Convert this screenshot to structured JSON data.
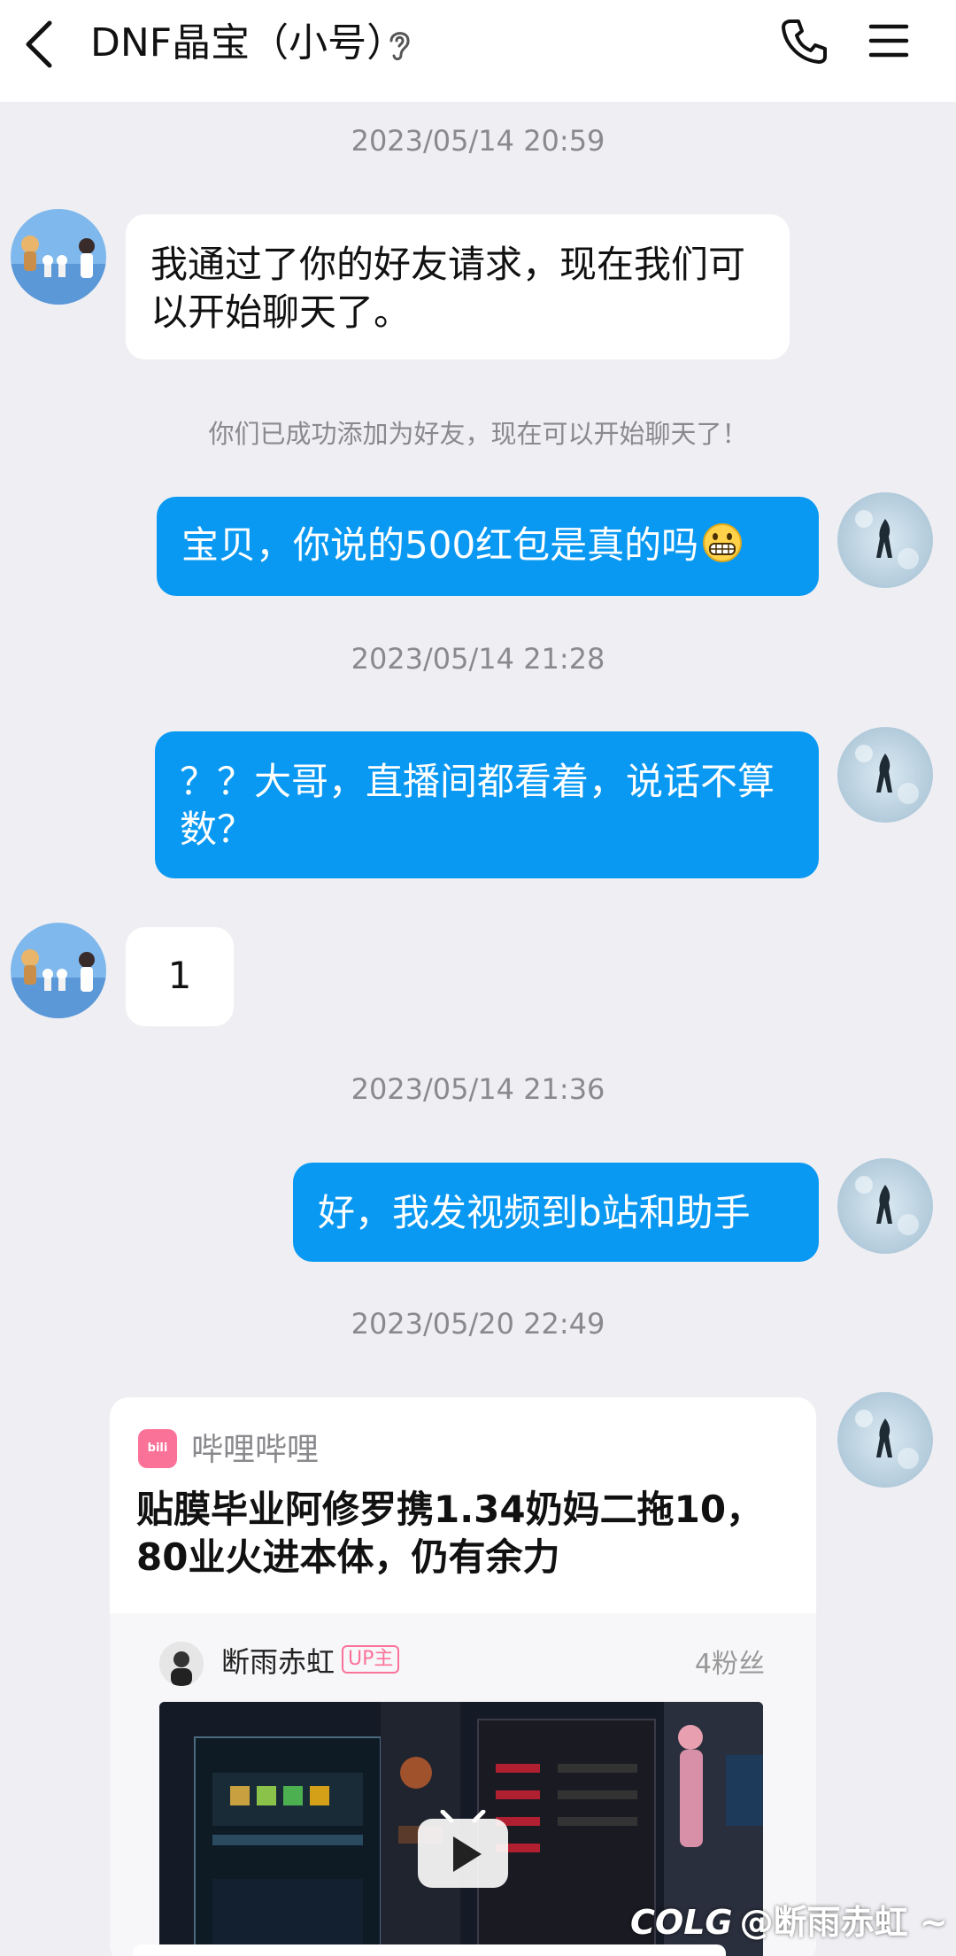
{
  "header": {
    "title": "DNF晶宝（小号）",
    "back_icon": "chevron-left-icon",
    "ear_icon": "ear-icon",
    "phone_icon": "phone-icon",
    "menu_icon": "menu-icon"
  },
  "messages": [
    {
      "kind": "timestamp",
      "text": "2023/05/14 20:59"
    },
    {
      "kind": "incoming",
      "text": "我通过了你的好友请求，现在我们可以开始聊天了。"
    },
    {
      "kind": "system",
      "text": "你们已成功添加为好友，现在可以开始聊天了！"
    },
    {
      "kind": "outgoing",
      "text": "宝贝，你说的500红包是真的吗",
      "emoji": "grinning-emoji"
    },
    {
      "kind": "timestamp",
      "text": "2023/05/14 21:28"
    },
    {
      "kind": "outgoing",
      "text": "？？大哥，直播间都看着，说话不算数？"
    },
    {
      "kind": "incoming",
      "text": "1"
    },
    {
      "kind": "timestamp",
      "text": "2023/05/14 21:36"
    },
    {
      "kind": "outgoing",
      "text": "好，我发视频到b站和助手"
    },
    {
      "kind": "timestamp",
      "text": "2023/05/20 22:49"
    }
  ],
  "share_card": {
    "source_logo": "bilibili",
    "source_name": "哔哩哔哩",
    "title": "贴膜毕业阿修罗携1.34奶妈二拖10，80业火进本体，仍有余力",
    "uploader": "断雨赤虹",
    "badge": "UP主",
    "fans": "4粉丝",
    "play_icon": "play-icon"
  },
  "watermark": {
    "brand": "COLG",
    "handle": "@断雨赤虹 ~"
  },
  "colors": {
    "outgoing_bubble": "#0a99f2",
    "incoming_bubble": "#ffffff",
    "background": "#efeff3",
    "bilibili_pink": "#fb7299"
  }
}
